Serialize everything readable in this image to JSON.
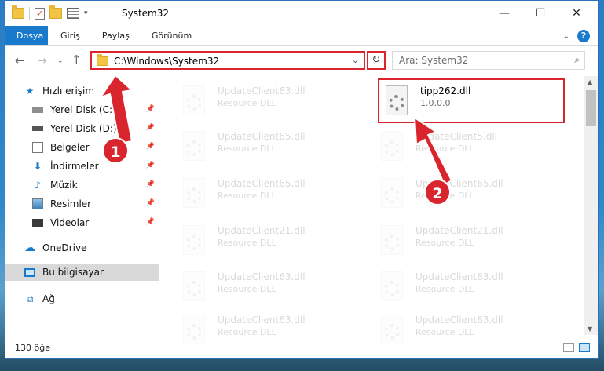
{
  "window": {
    "title": "System32"
  },
  "ribbon": {
    "tabs": [
      "Dosya",
      "Giriş",
      "Paylaş",
      "Görünüm"
    ]
  },
  "address": {
    "path": "C:\\Windows\\System32",
    "search_placeholder": "Ara: System32"
  },
  "nav": {
    "items": [
      {
        "label": "Hızlı erişim",
        "icon": "star-icon",
        "pinned": false
      },
      {
        "label": "Yerel Disk (C:)",
        "icon": "drive-icon",
        "pinned": true
      },
      {
        "label": "Yerel Disk (D:)",
        "icon": "drive-icon",
        "pinned": true
      },
      {
        "label": "Belgeler",
        "icon": "document-icon",
        "pinned": true
      },
      {
        "label": "İndirmeler",
        "icon": "download-icon",
        "pinned": true
      },
      {
        "label": "Müzik",
        "icon": "music-icon",
        "pinned": true
      },
      {
        "label": "Resimler",
        "icon": "picture-icon",
        "pinned": true
      },
      {
        "label": "Videolar",
        "icon": "video-icon",
        "pinned": true
      },
      {
        "label": "OneDrive",
        "icon": "cloud-icon",
        "pinned": false
      },
      {
        "label": "Bu bilgisayar",
        "icon": "computer-icon",
        "pinned": false
      },
      {
        "label": "Ağ",
        "icon": "network-icon",
        "pinned": false
      }
    ]
  },
  "files": {
    "highlighted": {
      "name": "tipp262.dll",
      "sub": "1.0.0.0"
    },
    "left_column": [
      {
        "name": "UpdateClient63.dll",
        "sub": "Resource DLL"
      },
      {
        "name": "UpdateClient65.dll",
        "sub": "Resource DLL"
      },
      {
        "name": "UpdateClient65.dll",
        "sub": "Resource DLL"
      },
      {
        "name": "UpdateClient21.dll",
        "sub": "Resource DLL"
      },
      {
        "name": "UpdateClient63.dll",
        "sub": "Resource DLL"
      },
      {
        "name": "UpdateClient63.dll",
        "sub": "Resource DLL"
      }
    ],
    "right_column": [
      {
        "name": "UpdateClient5.dll",
        "sub": "Resource DLL"
      },
      {
        "name": "UpdateClient65.dll",
        "sub": "Resource DLL"
      },
      {
        "name": "UpdateClient21.dll",
        "sub": "Resource DLL"
      },
      {
        "name": "UpdateClient63.dll",
        "sub": "Resource DLL"
      },
      {
        "name": "UpdateClient63.dll",
        "sub": "Resource DLL"
      }
    ]
  },
  "status": {
    "count": "130 öğe"
  },
  "annotations": {
    "step1": "1",
    "step2": "2"
  },
  "colors": {
    "accent": "#1979ca",
    "highlight": "#d9262e"
  }
}
